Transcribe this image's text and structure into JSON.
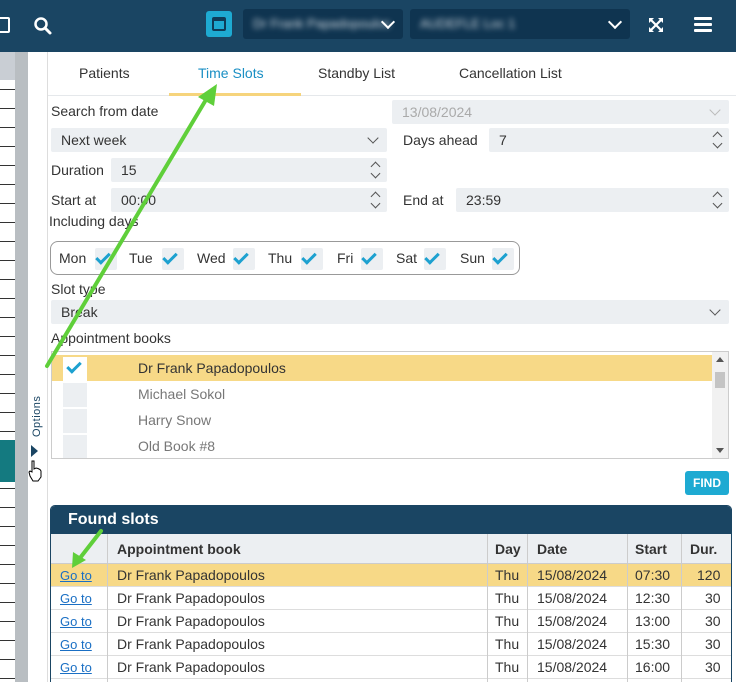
{
  "topbar": {
    "doctor_select": "Dr Frank Papadopoulos",
    "location_select": "AUDEFLE Loc 1"
  },
  "sidebar": {
    "options_label": "Options"
  },
  "tabs": [
    {
      "label": "Patients"
    },
    {
      "label": "Time Slots"
    },
    {
      "label": "Standby List"
    },
    {
      "label": "Cancellation List"
    }
  ],
  "form": {
    "search_from_date_label": "Search from date",
    "search_from_date_value": "13/08/2024",
    "range_value": "Next week",
    "days_ahead_label": "Days ahead",
    "days_ahead_value": "7",
    "duration_label": "Duration",
    "duration_value": "15",
    "start_at_label": "Start at",
    "start_at_value": "00:00",
    "end_at_label": "End at",
    "end_at_value": "23:59",
    "including_days_label": "Including days",
    "days": [
      "Mon",
      "Tue",
      "Wed",
      "Thu",
      "Fri",
      "Sat",
      "Sun"
    ],
    "slot_type_label": "Slot type",
    "slot_type_value": "Break",
    "appointment_books_label": "Appointment books",
    "books": [
      "Dr Frank Papadopoulos",
      "Michael Sokol",
      "Harry Snow",
      "Old Book #8"
    ],
    "find_label": "FIND"
  },
  "found": {
    "title": "Found slots",
    "columns": [
      "Appointment book",
      "Day",
      "Date",
      "Start",
      "Dur."
    ],
    "rows": [
      {
        "link": "Go to",
        "book": "Dr Frank Papadopoulos",
        "day": "Thu",
        "date": "15/08/2024",
        "start": "07:30",
        "dur": "120"
      },
      {
        "link": "Go to",
        "book": "Dr Frank Papadopoulos",
        "day": "Thu",
        "date": "15/08/2024",
        "start": "12:30",
        "dur": "30"
      },
      {
        "link": "Go to",
        "book": "Dr Frank Papadopoulos",
        "day": "Thu",
        "date": "15/08/2024",
        "start": "13:00",
        "dur": "30"
      },
      {
        "link": "Go to",
        "book": "Dr Frank Papadopoulos",
        "day": "Thu",
        "date": "15/08/2024",
        "start": "15:30",
        "dur": "30"
      },
      {
        "link": "Go to",
        "book": "Dr Frank Papadopoulos",
        "day": "Thu",
        "date": "15/08/2024",
        "start": "16:00",
        "dur": "30"
      }
    ]
  },
  "colors": {
    "header": "#1a4563",
    "accent": "#1eaad2",
    "highlight": "#f7d987",
    "annotation_arrow": "#5fcf3a"
  }
}
